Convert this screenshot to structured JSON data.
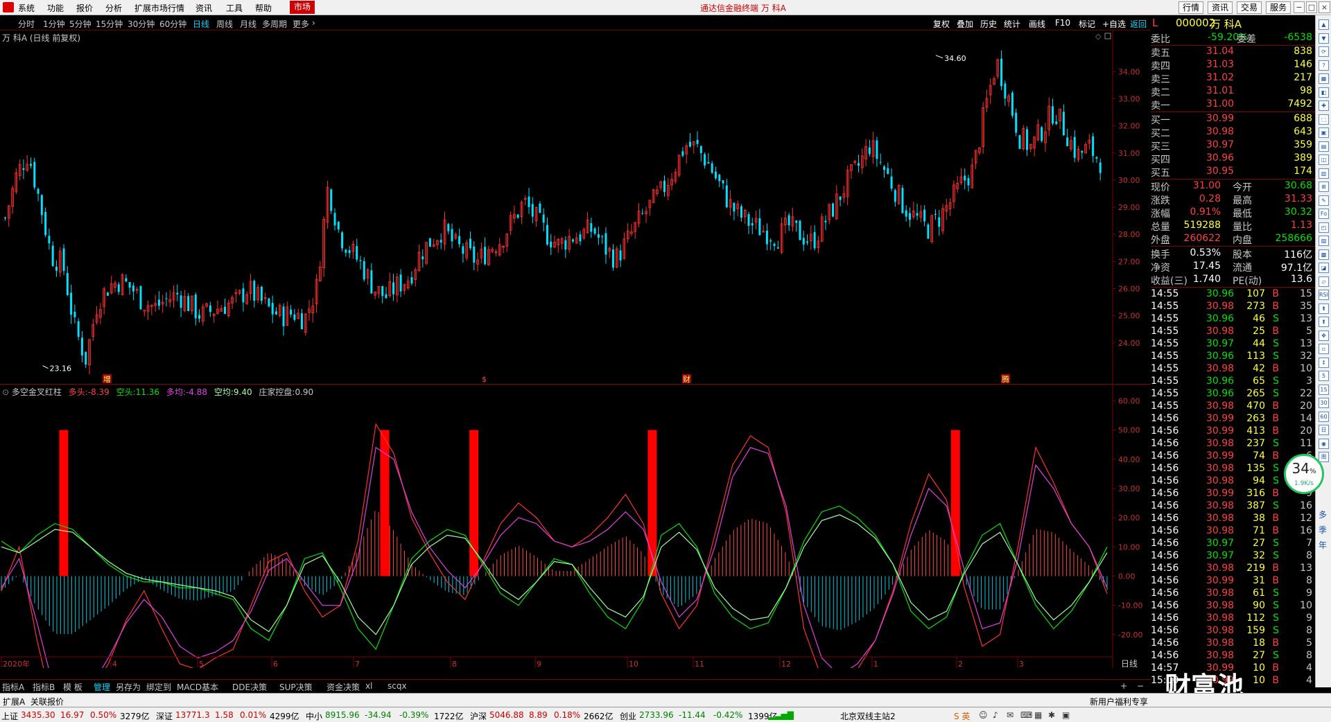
{
  "menu": {
    "items": [
      "系统",
      "功能",
      "报价",
      "分析",
      "扩展市场行情",
      "资讯",
      "工具",
      "帮助"
    ],
    "active": "市场",
    "title": "通达信金融终端  万 科A",
    "right_buttons": [
      "行情",
      "资讯",
      "交易",
      "服务"
    ],
    "window_controls": [
      "−",
      "□",
      "×"
    ]
  },
  "periods": {
    "items": [
      "分时",
      "1分钟",
      "5分钟",
      "15分钟",
      "30分钟",
      "60分钟",
      "日线",
      "周线",
      "月线",
      "多周期",
      "更多"
    ],
    "selected": "日线",
    "tools": [
      "复权",
      "叠加",
      "历史",
      "统计",
      "画线",
      "F10",
      "标记",
      "+自选",
      "返回"
    ]
  },
  "chart_header": {
    "stock_title": "万 科A (日线 前复权)",
    "high_label": "34.60",
    "low_label": "23.16",
    "markers": [
      "增",
      "$",
      "财",
      "腾"
    ]
  },
  "indicator": {
    "name": "多空金叉红柱",
    "items": [
      {
        "label": "多头:",
        "value": "-8.39"
      },
      {
        "label": "空头:",
        "value": "11.36"
      },
      {
        "label": "多均:",
        "value": "-4.88"
      },
      {
        "label": "空均:",
        "value": "9.40"
      },
      {
        "label": "庄家控盘:",
        "value": "0.90"
      }
    ]
  },
  "chart_data": [
    {
      "type": "candlestick",
      "title": "万 科A (日线 前复权)",
      "y_ticks": [
        "34.00",
        "33.00",
        "32.00",
        "31.00",
        "30.00",
        "29.00",
        "28.00",
        "27.00",
        "26.00",
        "25.00",
        "24.00"
      ],
      "ylim": [
        23.0,
        34.8
      ],
      "high_annotation": 34.6,
      "low_annotation": 23.16,
      "close_path": [
        28.6,
        30.2,
        31.0,
        29.2,
        27.2,
        26.9,
        24.6,
        23.4,
        25.5,
        26.1,
        26.3,
        26.0,
        25.5,
        25.3,
        25.6,
        25.8,
        25.4,
        25.0,
        25.2,
        25.4,
        25.5,
        26.0,
        25.6,
        25.2,
        25.0,
        25.1,
        24.9,
        26.0,
        29.8,
        28.0,
        27.4,
        26.8,
        26.0,
        25.7,
        26.1,
        26.4,
        27.3,
        27.8,
        28.2,
        27.6,
        27.3,
        27.0,
        27.5,
        27.8,
        28.5,
        29.2,
        28.6,
        28.0,
        27.6,
        27.9,
        28.0,
        28.2,
        27.5,
        27.1,
        27.8,
        28.5,
        29.1,
        29.6,
        30.4,
        31.3,
        31.2,
        30.6,
        29.8,
        29.0,
        28.6,
        28.3,
        28.1,
        27.9,
        28.3,
        28.0,
        27.7,
        28.4,
        29.1,
        29.9,
        30.5,
        31.3,
        30.6,
        29.8,
        29.0,
        28.6,
        28.2,
        28.6,
        29.2,
        29.9,
        30.4,
        32.6,
        34.4,
        33.1,
        31.6,
        31.2,
        31.9,
        32.6,
        31.8,
        30.9,
        31.2,
        30.7
      ],
      "x_ticks": [
        "2020年",
        "4",
        "5",
        "6",
        "7",
        "8",
        "9",
        "10",
        "11",
        "12",
        "1",
        "2",
        "3"
      ]
    },
    {
      "type": "line",
      "title": "多空金叉红柱",
      "y_ticks": [
        "60.00",
        "50.00",
        "40.00",
        "30.00",
        "20.00",
        "10.00",
        "0.00",
        "-10.00",
        "-20.00"
      ],
      "ylim": [
        -30,
        62
      ],
      "series": [
        {
          "name": "多头",
          "color": "#ff3030",
          "values": [
            -5,
            10,
            -22,
            -48,
            -50,
            -40,
            -30,
            -15,
            -5,
            -18,
            -30,
            -32,
            -28,
            -25,
            -10,
            5,
            8,
            -5,
            -14,
            -10,
            12,
            52,
            42,
            20,
            8,
            -2,
            -8,
            5,
            18,
            25,
            20,
            12,
            10,
            14,
            20,
            28,
            18,
            -6,
            -18,
            -10,
            14,
            38,
            48,
            44,
            22,
            -18,
            -35,
            -38,
            -32,
            -22,
            -5,
            18,
            35,
            26,
            -4,
            -24,
            -20,
            10,
            44,
            32,
            18,
            10,
            -6
          ]
        },
        {
          "name": "空头",
          "color": "#00e000",
          "values": [
            12,
            8,
            14,
            18,
            16,
            10,
            4,
            0,
            -2,
            -2,
            -4,
            -4,
            -6,
            -8,
            -18,
            -22,
            -10,
            6,
            8,
            -4,
            -18,
            -25,
            -10,
            6,
            12,
            16,
            14,
            4,
            -6,
            -10,
            -2,
            6,
            4,
            -6,
            -14,
            -18,
            -8,
            14,
            18,
            10,
            -6,
            -14,
            -18,
            -16,
            -4,
            12,
            22,
            24,
            20,
            14,
            4,
            -12,
            -18,
            -14,
            2,
            14,
            18,
            4,
            -10,
            -18,
            -12,
            -2,
            10
          ]
        },
        {
          "name": "多均",
          "color": "#e040e0",
          "values": [
            -4,
            6,
            -16,
            -40,
            -46,
            -38,
            -28,
            -16,
            -8,
            -14,
            -24,
            -28,
            -26,
            -22,
            -12,
            2,
            6,
            -2,
            -10,
            -10,
            6,
            44,
            40,
            22,
            10,
            2,
            -4,
            4,
            14,
            20,
            18,
            12,
            10,
            12,
            16,
            22,
            16,
            -2,
            -14,
            -8,
            10,
            34,
            44,
            42,
            24,
            -10,
            -28,
            -34,
            -30,
            -22,
            -6,
            14,
            30,
            24,
            2,
            -18,
            -16,
            6,
            38,
            30,
            18,
            10,
            -4
          ]
        },
        {
          "name": "空均",
          "color": "#a0ffa0",
          "values": [
            10,
            8,
            12,
            16,
            15,
            10,
            5,
            1,
            -1,
            -2,
            -3,
            -4,
            -5,
            -7,
            -15,
            -19,
            -10,
            4,
            7,
            -2,
            -14,
            -20,
            -10,
            4,
            10,
            14,
            13,
            5,
            -4,
            -8,
            -2,
            5,
            4,
            -4,
            -11,
            -14,
            -7,
            10,
            15,
            9,
            -4,
            -11,
            -15,
            -14,
            -4,
            10,
            19,
            21,
            18,
            13,
            4,
            -9,
            -15,
            -12,
            1,
            11,
            15,
            4,
            -8,
            -15,
            -10,
            -2,
            8
          ]
        }
      ],
      "red_bars_at_index": [
        2,
        20,
        25,
        35,
        52,
        66,
        73
      ]
    }
  ],
  "quote": {
    "code": "000002",
    "name": "万 科A",
    "weibi": {
      "label": "委比",
      "value": "-59.20%",
      "label2": "委差",
      "value2": "-6538"
    },
    "asks": [
      {
        "label": "卖五",
        "price": "31.04",
        "vol": "838"
      },
      {
        "label": "卖四",
        "price": "31.03",
        "vol": "146"
      },
      {
        "label": "卖三",
        "price": "31.02",
        "vol": "217"
      },
      {
        "label": "卖二",
        "price": "31.01",
        "vol": "98"
      },
      {
        "label": "卖一",
        "price": "31.00",
        "vol": "7492"
      }
    ],
    "bids": [
      {
        "label": "买一",
        "price": "30.99",
        "vol": "688"
      },
      {
        "label": "买二",
        "price": "30.98",
        "vol": "643"
      },
      {
        "label": "买三",
        "price": "30.97",
        "vol": "359"
      },
      {
        "label": "买四",
        "price": "30.96",
        "vol": "389"
      },
      {
        "label": "买五",
        "price": "30.95",
        "vol": "174"
      }
    ],
    "stats": [
      {
        "l1": "现价",
        "v1": "31.00",
        "c1": "red",
        "l2": "今开",
        "v2": "30.68",
        "c2": "green"
      },
      {
        "l1": "涨跌",
        "v1": "0.28",
        "c1": "red",
        "l2": "最高",
        "v2": "31.33",
        "c2": "red"
      },
      {
        "l1": "涨幅",
        "v1": "0.91%",
        "c1": "red",
        "l2": "最低",
        "v2": "30.32",
        "c2": "green"
      },
      {
        "l1": "总量",
        "v1": "519288",
        "c1": "yellow",
        "l2": "量比",
        "v2": "1.13",
        "c2": "red"
      },
      {
        "l1": "外盘",
        "v1": "260622",
        "c1": "red",
        "l2": "内盘",
        "v2": "258666",
        "c2": "green"
      }
    ],
    "stats2": [
      {
        "l1": "换手",
        "v1": "0.53%",
        "l2": "股本",
        "v2": "116亿"
      },
      {
        "l1": "净资",
        "v1": "17.45",
        "l2": "流通",
        "v2": "97.1亿"
      },
      {
        "l1": "收益(三)",
        "v1": "1.740",
        "l2": "PE(动)",
        "v2": "13.6"
      }
    ],
    "ticks": [
      {
        "t": "14:55",
        "p": "30.96",
        "v": "107",
        "d": "B",
        "n": "15"
      },
      {
        "t": "14:55",
        "p": "30.98",
        "v": "273",
        "d": "B",
        "n": "35"
      },
      {
        "t": "14:55",
        "p": "30.96",
        "v": "46",
        "d": "S",
        "n": "13"
      },
      {
        "t": "14:55",
        "p": "30.98",
        "v": "25",
        "d": "B",
        "n": "5"
      },
      {
        "t": "14:55",
        "p": "30.97",
        "v": "44",
        "d": "S",
        "n": "13"
      },
      {
        "t": "14:55",
        "p": "30.96",
        "v": "113",
        "d": "S",
        "n": "32"
      },
      {
        "t": "14:55",
        "p": "30.98",
        "v": "42",
        "d": "B",
        "n": "10"
      },
      {
        "t": "14:55",
        "p": "30.96",
        "v": "65",
        "d": "S",
        "n": "3"
      },
      {
        "t": "14:55",
        "p": "30.96",
        "v": "265",
        "d": "S",
        "n": "22"
      },
      {
        "t": "14:55",
        "p": "30.98",
        "v": "470",
        "d": "B",
        "n": "20"
      },
      {
        "t": "14:56",
        "p": "30.99",
        "v": "263",
        "d": "B",
        "n": "14"
      },
      {
        "t": "14:56",
        "p": "30.99",
        "v": "413",
        "d": "B",
        "n": "20"
      },
      {
        "t": "14:56",
        "p": "30.98",
        "v": "237",
        "d": "S",
        "n": "11"
      },
      {
        "t": "14:56",
        "p": "30.99",
        "v": "74",
        "d": "B",
        "n": "6"
      },
      {
        "t": "14:56",
        "p": "30.98",
        "v": "135",
        "d": "S",
        "n": "4"
      },
      {
        "t": "14:56",
        "p": "30.98",
        "v": "94",
        "d": "S",
        "n": "8"
      },
      {
        "t": "14:56",
        "p": "30.99",
        "v": "316",
        "d": "B",
        "n": "9"
      },
      {
        "t": "14:56",
        "p": "30.98",
        "v": "387",
        "d": "S",
        "n": "16"
      },
      {
        "t": "14:56",
        "p": "30.98",
        "v": "38",
        "d": "B",
        "n": "12"
      },
      {
        "t": "14:56",
        "p": "30.98",
        "v": "71",
        "d": "B",
        "n": "16"
      },
      {
        "t": "14:56",
        "p": "30.97",
        "v": "27",
        "d": "S",
        "n": "7"
      },
      {
        "t": "14:56",
        "p": "30.97",
        "v": "32",
        "d": "S",
        "n": "8"
      },
      {
        "t": "14:56",
        "p": "30.98",
        "v": "219",
        "d": "B",
        "n": "13"
      },
      {
        "t": "14:56",
        "p": "30.99",
        "v": "31",
        "d": "B",
        "n": "8"
      },
      {
        "t": "14:56",
        "p": "30.98",
        "v": "61",
        "d": "S",
        "n": "9"
      },
      {
        "t": "14:56",
        "p": "30.98",
        "v": "90",
        "d": "S",
        "n": "10"
      },
      {
        "t": "14:56",
        "p": "30.98",
        "v": "112",
        "d": "S",
        "n": "9"
      },
      {
        "t": "14:56",
        "p": "30.98",
        "v": "159",
        "d": "S",
        "n": "8"
      },
      {
        "t": "14:56",
        "p": "30.98",
        "v": "18",
        "d": "B",
        "n": "5"
      },
      {
        "t": "14:56",
        "p": "30.98",
        "v": "27",
        "d": "S",
        "n": "8"
      },
      {
        "t": "14:57",
        "p": "30.99",
        "v": "10",
        "d": "B",
        "n": "4"
      },
      {
        "t": "15:00",
        "p": "30.99",
        "v": "10",
        "d": "B",
        "n": "4"
      }
    ]
  },
  "side_icons": [
    "多",
    "季",
    "年"
  ],
  "speed": {
    "percent": "34",
    "unit": "%",
    "rate": "1.9K/s"
  },
  "bottom_tabs": [
    "指标A",
    "指标B",
    "模 板",
    "管理",
    "另存为",
    "绑定到",
    "MACD基本",
    "DDE决策",
    "SUP决策",
    "资金决策",
    "xl",
    "scqx"
  ],
  "bottom_tab_selected": "管理",
  "daily_label": "日线",
  "status1": [
    "扩展A",
    "关联报价"
  ],
  "status1_right": "新用户福利专享",
  "status2": [
    {
      "name": "上证",
      "v": "3435.30",
      "c": "16.97",
      "p": "0.50%",
      "a": "3279亿",
      "col": "red"
    },
    {
      "name": "深证",
      "v": "13771.3",
      "c": "1.58",
      "p": "0.01%",
      "a": "4299亿",
      "col": "red"
    },
    {
      "name": "中小",
      "v": "8915.96",
      "c": "-34.94",
      "p": "-0.39%",
      "a": "1722亿",
      "col": "green"
    },
    {
      "name": "沪深",
      "v": "5046.88",
      "c": "8.89",
      "p": "0.18%",
      "a": "2662亿",
      "col": "red"
    },
    {
      "name": "创业",
      "v": "2733.96",
      "c": "-11.44",
      "p": "-0.42%",
      "a": "1399亿",
      "col": "green"
    }
  ],
  "server": "北京双线主站2",
  "ime": "英",
  "watermark": "财富池"
}
